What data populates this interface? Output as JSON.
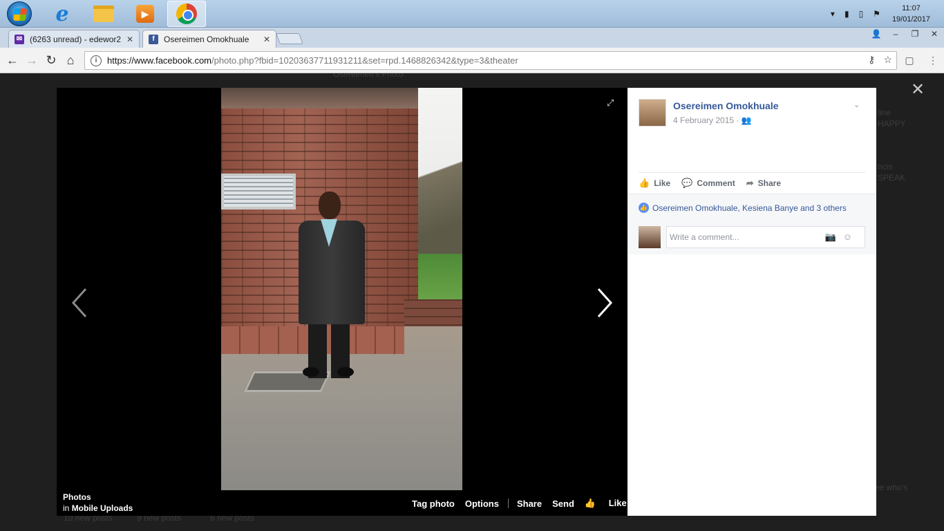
{
  "taskbar": {
    "clock_time": "11:07",
    "clock_date": "19/01/2017"
  },
  "browser": {
    "tabs": [
      {
        "title": "(6263 unread) - edewor2",
        "active": false
      },
      {
        "title": "Osereimen Omokhuale",
        "active": true
      }
    ],
    "url_host": "https://www.facebook.com",
    "url_path": "/photo.php?fbid=10203637711931211&set=rpd.1468826342&type=3&theater"
  },
  "theater": {
    "caption_album": "Photos",
    "caption_prefix": "in",
    "caption_source": "Mobile Uploads",
    "actions": {
      "tag_photo": "Tag photo",
      "options": "Options",
      "share": "Share",
      "send": "Send",
      "like": "Like"
    }
  },
  "post": {
    "author": "Osereimen Omokhuale",
    "date": "4 February 2015",
    "actions": {
      "like": "Like",
      "comment": "Comment",
      "share": "Share"
    },
    "likes_text": "Osereimen Omokhuale, Kesiena Banye and 3 others",
    "comment_placeholder": "Write a comment..."
  },
  "background_ghost_text": {
    "top_name": "Osereimen's Photo",
    "bottom_a": "10 new posts",
    "bottom_b": "9 new posts",
    "bottom_c": "6 new posts",
    "side_a": "line",
    "side_b": "HAPPY",
    "side_c": "ncis",
    "side_d": "SPEAK",
    "side_e": "ee who's"
  },
  "colors": {
    "fb_link": "#365899",
    "like_blue": "#5890ff",
    "overlay": "#1f1f1f"
  }
}
